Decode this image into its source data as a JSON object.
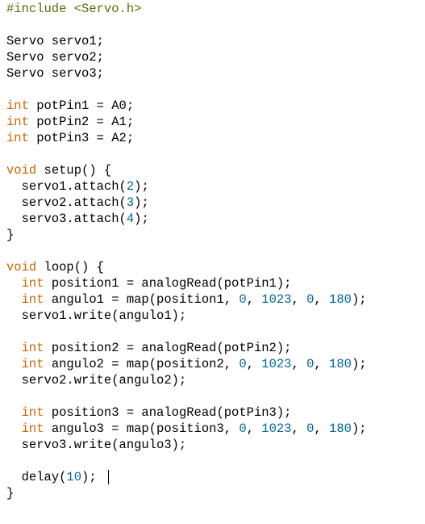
{
  "editor": {
    "colors": {
      "text": "#000000",
      "keyword": "#cc6600",
      "number": "#006699",
      "preprocessor": "#5e6d03",
      "background": "#ffffff"
    },
    "lines": [
      [
        {
          "t": "#include <Servo.h>",
          "c": "pp"
        }
      ],
      [],
      [
        {
          "t": "Servo servo1;"
        }
      ],
      [
        {
          "t": "Servo servo2;"
        }
      ],
      [
        {
          "t": "Servo servo3;"
        }
      ],
      [],
      [
        {
          "t": "int",
          "c": "kw"
        },
        {
          "t": " potPin1 = A0;"
        }
      ],
      [
        {
          "t": "int",
          "c": "kw"
        },
        {
          "t": " potPin2 = A1;"
        }
      ],
      [
        {
          "t": "int",
          "c": "kw"
        },
        {
          "t": " potPin3 = A2;"
        }
      ],
      [],
      [
        {
          "t": "void",
          "c": "kw"
        },
        {
          "t": " setup() {"
        }
      ],
      [
        {
          "t": "  servo1.attach("
        },
        {
          "t": "2",
          "c": "num"
        },
        {
          "t": ");"
        }
      ],
      [
        {
          "t": "  servo2.attach("
        },
        {
          "t": "3",
          "c": "num"
        },
        {
          "t": ");"
        }
      ],
      [
        {
          "t": "  servo3.attach("
        },
        {
          "t": "4",
          "c": "num"
        },
        {
          "t": ");"
        }
      ],
      [
        {
          "t": "}"
        }
      ],
      [],
      [
        {
          "t": "void",
          "c": "kw"
        },
        {
          "t": " loop() {"
        }
      ],
      [
        {
          "t": "  "
        },
        {
          "t": "int",
          "c": "kw"
        },
        {
          "t": " position1 = analogRead(potPin1);"
        }
      ],
      [
        {
          "t": "  "
        },
        {
          "t": "int",
          "c": "kw"
        },
        {
          "t": " angulo1 = map(position1, "
        },
        {
          "t": "0",
          "c": "num"
        },
        {
          "t": ", "
        },
        {
          "t": "1023",
          "c": "num"
        },
        {
          "t": ", "
        },
        {
          "t": "0",
          "c": "num"
        },
        {
          "t": ", "
        },
        {
          "t": "180",
          "c": "num"
        },
        {
          "t": ");"
        }
      ],
      [
        {
          "t": "  servo1.write(angulo1);"
        }
      ],
      [],
      [
        {
          "t": "  "
        },
        {
          "t": "int",
          "c": "kw"
        },
        {
          "t": " position2 = analogRead(potPin2);"
        }
      ],
      [
        {
          "t": "  "
        },
        {
          "t": "int",
          "c": "kw"
        },
        {
          "t": " angulo2 = map(position2, "
        },
        {
          "t": "0",
          "c": "num"
        },
        {
          "t": ", "
        },
        {
          "t": "1023",
          "c": "num"
        },
        {
          "t": ", "
        },
        {
          "t": "0",
          "c": "num"
        },
        {
          "t": ", "
        },
        {
          "t": "180",
          "c": "num"
        },
        {
          "t": ");"
        }
      ],
      [
        {
          "t": "  servo2.write(angulo2);"
        }
      ],
      [],
      [
        {
          "t": "  "
        },
        {
          "t": "int",
          "c": "kw"
        },
        {
          "t": " position3 = analogRead(potPin3);"
        }
      ],
      [
        {
          "t": "  "
        },
        {
          "t": "int",
          "c": "kw"
        },
        {
          "t": " angulo3 = map(position3, "
        },
        {
          "t": "0",
          "c": "num"
        },
        {
          "t": ", "
        },
        {
          "t": "1023",
          "c": "num"
        },
        {
          "t": ", "
        },
        {
          "t": "0",
          "c": "num"
        },
        {
          "t": ", "
        },
        {
          "t": "180",
          "c": "num"
        },
        {
          "t": ");"
        }
      ],
      [
        {
          "t": "  servo3.write(angulo3);"
        }
      ],
      [],
      [
        {
          "t": "  delay("
        },
        {
          "t": "10",
          "c": "num"
        },
        {
          "t": ");"
        }
      ],
      [
        {
          "t": "}"
        }
      ]
    ],
    "caret_line": 29
  }
}
